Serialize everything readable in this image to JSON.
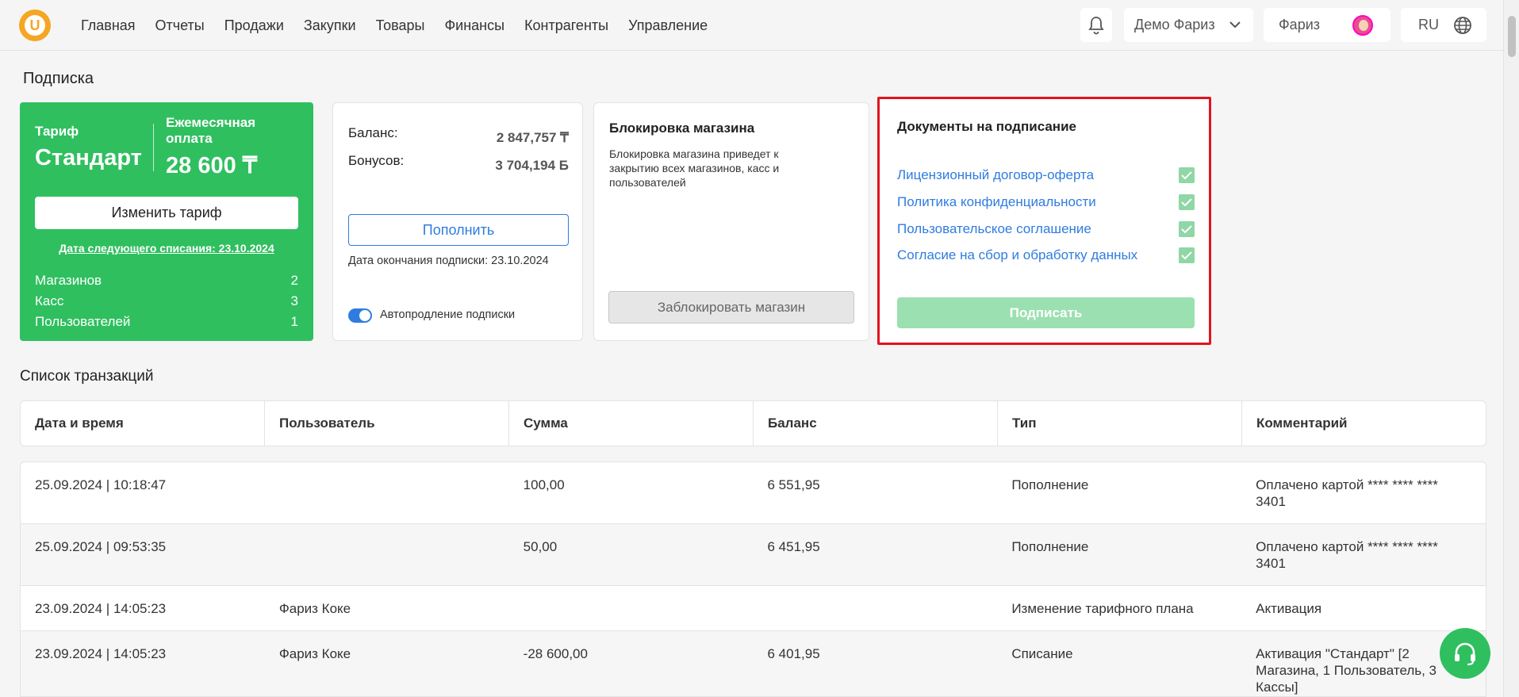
{
  "header": {
    "nav": [
      "Главная",
      "Отчеты",
      "Продажи",
      "Закупки",
      "Товары",
      "Финансы",
      "Контрагенты",
      "Управление"
    ],
    "company": "Демо Фариз",
    "user": "Фариз",
    "lang": "RU"
  },
  "page_title": "Подписка",
  "tariff": {
    "label": "Тариф",
    "plan": "Стандарт",
    "monthly_label": "Ежемесячная оплата",
    "price": "28 600 ₸",
    "change_button": "Изменить тариф",
    "next_charge": "Дата следующего списания: 23.10.2024",
    "counts": [
      {
        "label": "Магазинов",
        "value": "2"
      },
      {
        "label": "Касс",
        "value": "3"
      },
      {
        "label": "Пользователей",
        "value": "1"
      }
    ]
  },
  "balance": {
    "balance_label": "Баланс:",
    "balance_value": "2 847,757 ₸",
    "bonus_label": "Бонусов:",
    "bonus_value": "3 704,194 Б",
    "topup_button": "Пополнить",
    "sub_end": "Дата окончания подписки: 23.10.2024",
    "autorenew_label": "Автопродление подписки"
  },
  "block": {
    "title": "Блокировка магазина",
    "description": "Блокировка магазина приведет к закрытию всех магазинов, касс и пользователей",
    "button": "Заблокировать магазин"
  },
  "docs": {
    "title": "Документы на подписание",
    "items": [
      "Лицензионный договор-оферта",
      "Политика конфиденциальности",
      "Пользовательское соглашение",
      "Согласие на сбор и обработку данных"
    ],
    "sign_button": "Подписать"
  },
  "transactions": {
    "title": "Список транзакций",
    "columns": [
      "Дата и время",
      "Пользователь",
      "Сумма",
      "Баланс",
      "Тип",
      "Комментарий"
    ],
    "rows": [
      [
        "25.09.2024 | 10:18:47",
        "",
        "100,00",
        "6 551,95",
        "Пополнение",
        "Оплачено картой **** **** **** 3401"
      ],
      [
        "25.09.2024 | 09:53:35",
        "",
        "50,00",
        "6 451,95",
        "Пополнение",
        "Оплачено картой **** **** **** 3401"
      ],
      [
        "23.09.2024 | 14:05:23",
        "Фариз Коке",
        "",
        "",
        "Изменение тарифного плана",
        "Активация"
      ],
      [
        "23.09.2024 | 14:05:23",
        "Фариз Коке",
        "-28 600,00",
        "6 401,95",
        "Списание",
        "Активация \"Стандарт\" [2 Магазина, 1 Пользователь, 3 Кассы]"
      ]
    ]
  },
  "colors": {
    "accent": "#2fbf5f",
    "link": "#2f7ce0",
    "highlight": "#e1141f"
  }
}
